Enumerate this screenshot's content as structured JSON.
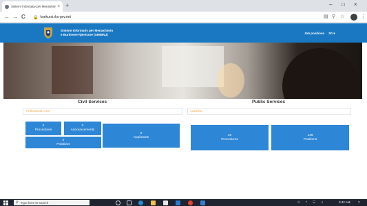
{
  "browser": {
    "tab_title": "Sistemi Informativ për Menaxhim",
    "tab_close": "×",
    "new_tab": "+",
    "url": "konkursi.rks-gov.net",
    "back": "←",
    "forward": "→",
    "reload": "C",
    "win_min": "–",
    "win_max": "□",
    "win_close": "×"
  },
  "header": {
    "title_line1": "Sistemi Informativ për Menaxhimin",
    "title_line2": "e Burimeve Njerëzore (SIMBNJ)",
    "link_positions": "Job positions",
    "link_language": "Sh",
    "link_caret": "▾"
  },
  "civil": {
    "title": "Civil Services",
    "tab": "Professional Level",
    "procedures_count": "0",
    "procedures_label": "Procedures",
    "announcements_count": "0",
    "announcements_label": "Announcements",
    "positions_count": "0",
    "positions_label": "Positions",
    "applicants_count": "0",
    "applicants_label": "Applicants"
  },
  "public": {
    "title": "Public Services",
    "tab": "Academic",
    "procedures_count": "40",
    "procedures_label": "Procedures",
    "positions_count": "149",
    "positions_label": "Positions"
  },
  "taskbar": {
    "search_placeholder": "Type here to search",
    "time": "3:42 AM"
  },
  "colors": {
    "brand_blue": "#1a78c2",
    "tile_blue": "#2e86d6",
    "tab_orange": "#f0a64d"
  }
}
